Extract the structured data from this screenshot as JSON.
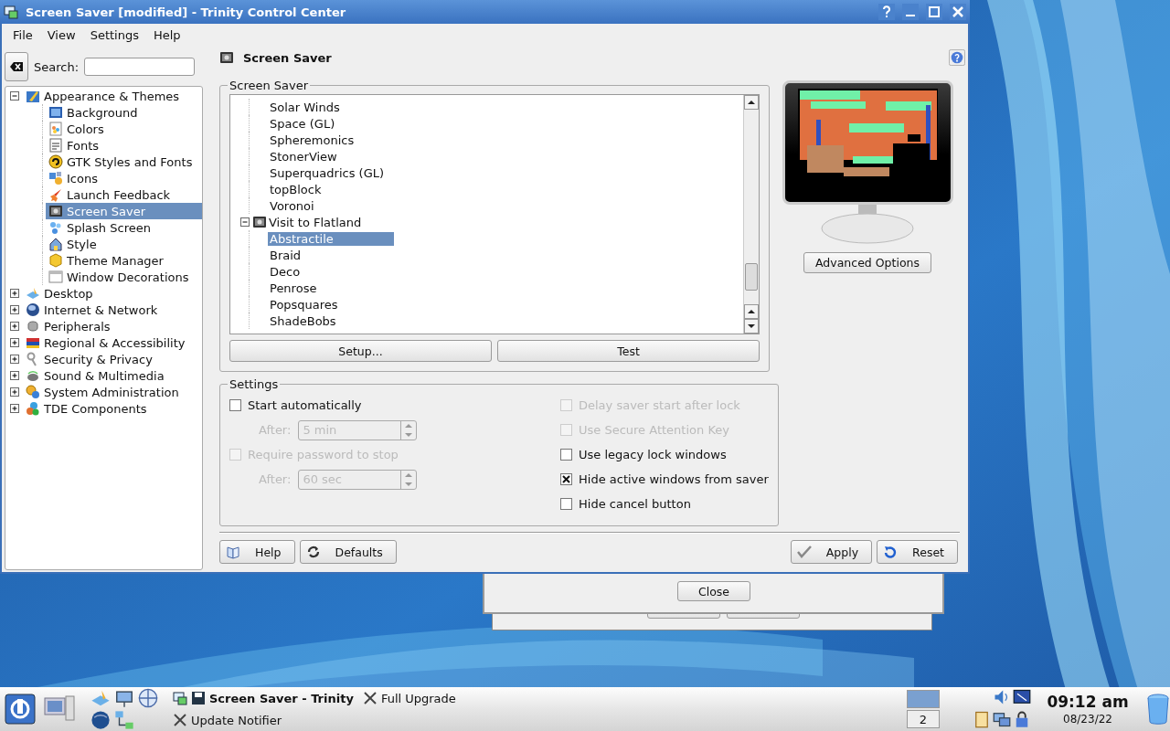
{
  "window": {
    "title": "Screen Saver [modified] - Trinity Control Center"
  },
  "menu": [
    "File",
    "View",
    "Settings",
    "Help"
  ],
  "search": {
    "label": "Search:"
  },
  "sidebar": {
    "items": [
      {
        "label": "Appearance & Themes",
        "expanded": true,
        "selected": false,
        "children": [
          {
            "label": "Background",
            "selected": false
          },
          {
            "label": "Colors",
            "selected": false
          },
          {
            "label": "Fonts",
            "selected": false
          },
          {
            "label": "GTK Styles and Fonts",
            "selected": false
          },
          {
            "label": "Icons",
            "selected": false
          },
          {
            "label": "Launch Feedback",
            "selected": false
          },
          {
            "label": "Screen Saver",
            "selected": true
          },
          {
            "label": "Splash Screen",
            "selected": false
          },
          {
            "label": "Style",
            "selected": false
          },
          {
            "label": "Theme Manager",
            "selected": false
          },
          {
            "label": "Window Decorations",
            "selected": false
          }
        ]
      },
      {
        "label": "Desktop",
        "expanded": false,
        "selected": false
      },
      {
        "label": "Internet & Network",
        "expanded": false,
        "selected": false
      },
      {
        "label": "Peripherals",
        "expanded": false,
        "selected": false
      },
      {
        "label": "Regional & Accessibility",
        "expanded": false,
        "selected": false
      },
      {
        "label": "Security & Privacy",
        "expanded": false,
        "selected": false
      },
      {
        "label": "Sound & Multimedia",
        "expanded": false,
        "selected": false
      },
      {
        "label": "System Administration",
        "expanded": false,
        "selected": false
      },
      {
        "label": "TDE Components",
        "expanded": false,
        "selected": false
      }
    ]
  },
  "page": {
    "title": "Screen Saver"
  },
  "screen_saver_group": {
    "title": "Screen Saver",
    "list": [
      {
        "children": [
          {
            "label": "Solar Winds",
            "selected": false
          },
          {
            "label": "Space (GL)",
            "selected": false
          },
          {
            "label": "Spheremonics",
            "selected": false
          },
          {
            "label": "StonerView",
            "selected": false
          },
          {
            "label": "Superquadrics (GL)",
            "selected": false
          },
          {
            "label": "topBlock",
            "selected": false
          },
          {
            "label": "Voronoi",
            "selected": false
          }
        ]
      },
      {
        "label": "Visit to Flatland",
        "expanded": true,
        "selected": false,
        "children": [
          {
            "label": "Abstractile",
            "selected": true
          },
          {
            "label": "Braid",
            "selected": false
          },
          {
            "label": "Deco",
            "selected": false
          },
          {
            "label": "Penrose",
            "selected": false
          },
          {
            "label": "Popsquares",
            "selected": false
          },
          {
            "label": "ShadeBobs",
            "selected": false
          }
        ]
      }
    ],
    "buttons": [
      "Setup...",
      "Test"
    ]
  },
  "preview": {
    "button": "Advanced Options"
  },
  "settings": {
    "title": "Settings",
    "left": [
      {
        "kind": "checkbox",
        "label": "Start automatically",
        "checked": false,
        "disabled": false
      },
      {
        "kind": "spin",
        "label": "After:",
        "value": "5 min",
        "disabled": true
      },
      {
        "kind": "checkbox",
        "label": "Require password to stop",
        "checked": false,
        "disabled": true
      },
      {
        "kind": "spin",
        "label": "After:",
        "value": "60 sec",
        "disabled": true
      }
    ],
    "right": [
      {
        "kind": "checkbox",
        "label": "Delay saver start after lock",
        "checked": false,
        "disabled": true
      },
      {
        "kind": "checkbox",
        "label": "Use Secure Attention Key",
        "checked": false,
        "disabled": true
      },
      {
        "kind": "checkbox",
        "label": "Use legacy lock windows",
        "checked": false,
        "disabled": false
      },
      {
        "kind": "checkbox",
        "label": "Hide active windows from saver",
        "checked": true,
        "disabled": false
      },
      {
        "kind": "checkbox",
        "label": "Hide cancel button",
        "checked": false,
        "disabled": false
      }
    ]
  },
  "footer": {
    "left_buttons": [
      "Help",
      "Defaults"
    ],
    "right_buttons": [
      "Apply",
      "Reset"
    ]
  },
  "background_dialog": {
    "button": "Close"
  },
  "taskbar": {
    "tasks": [
      {
        "label": "Screen Saver - Trinity",
        "active": true
      },
      {
        "label": "Update Notifier",
        "active": false
      },
      {
        "label": "Full Upgrade",
        "active": false
      }
    ],
    "pager": [
      {
        "selected": true
      },
      {
        "label": "2",
        "selected": false
      }
    ],
    "clock": {
      "time": "09:12 am",
      "date": "08/23/22"
    }
  }
}
